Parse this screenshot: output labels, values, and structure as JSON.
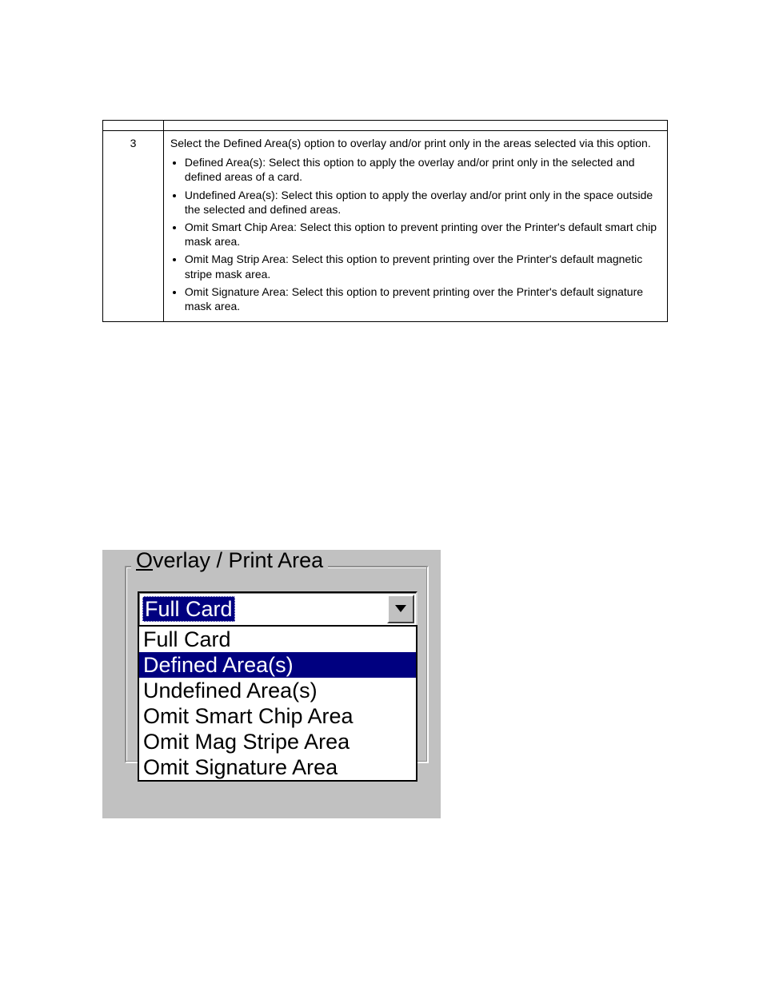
{
  "table": {
    "rows": [
      {
        "step": "",
        "desc": ""
      },
      {
        "step": "3",
        "desc": "Select the Defined Area(s) option to overlay and/or print only in the areas selected via this option.",
        "bullets": [
          "Defined Area(s): Select this option to apply the overlay and/or print only in the selected and defined areas of a card.",
          "Undefined Area(s): Select this option to apply the overlay and/or print only in the space outside the selected and defined areas.",
          "Omit Smart Chip Area: Select this option to prevent printing over the Printer's default smart chip mask area.",
          "Omit Mag Strip Area: Select this option to prevent printing over the Printer's default magnetic stripe mask area.",
          "Omit Signature Area: Select this option to prevent printing over the Printer's default signature mask area."
        ]
      }
    ]
  },
  "groupbox": {
    "legend_underline": "O",
    "legend_rest": "verlay / Print Area",
    "combo": {
      "selected": "Full Card",
      "options": [
        {
          "label": "Full Card",
          "selected": false
        },
        {
          "label": "Defined Area(s)",
          "selected": true
        },
        {
          "label": "Undefined Area(s)",
          "selected": false
        },
        {
          "label": "Omit Smart Chip Area",
          "selected": false
        },
        {
          "label": "Omit Mag Stripe Area",
          "selected": false
        },
        {
          "label": "Omit Signature Area",
          "selected": false
        }
      ]
    }
  }
}
